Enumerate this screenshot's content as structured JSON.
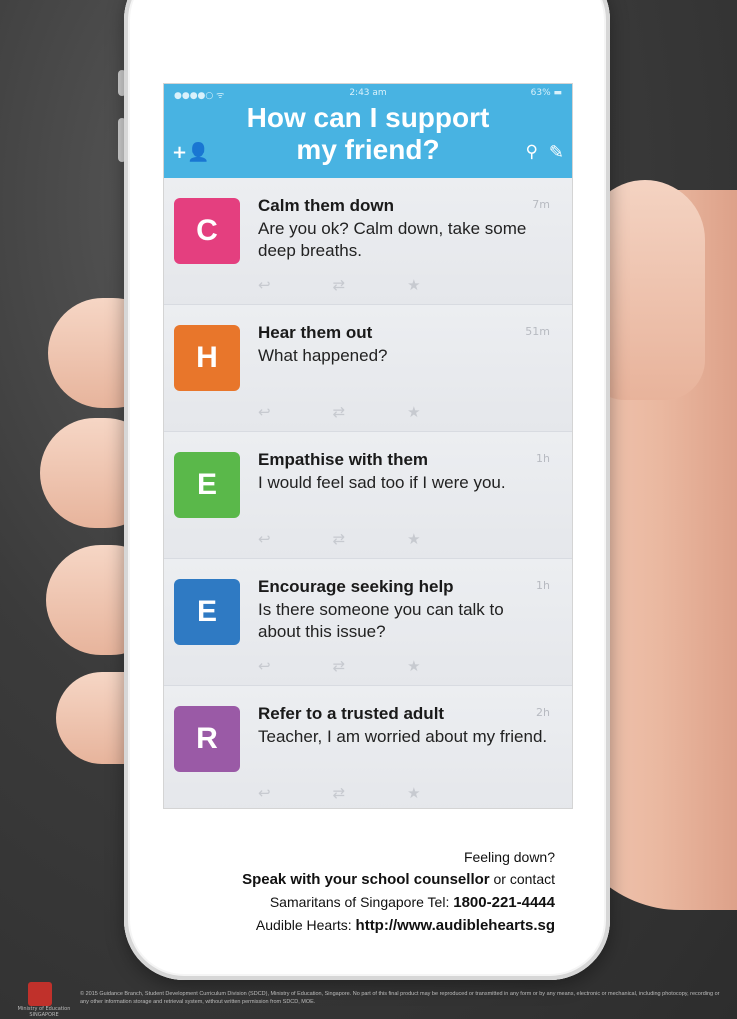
{
  "status_bar": {
    "signal": "●●●●○ ᯤ",
    "time": "2:43 am",
    "battery": "63% ▬"
  },
  "header": {
    "title_line1": "How can I support",
    "title_line2": "my friend?"
  },
  "icons": {
    "add_user": "+👤",
    "search": "⚲",
    "compose": "✎"
  },
  "feed": [
    {
      "letter": "C",
      "color": "#e43f7f",
      "title": "Calm them down",
      "text": "Are you ok? Calm down, take some deep breaths.",
      "time": "7m"
    },
    {
      "letter": "H",
      "color": "#e8762b",
      "title": "Hear them out",
      "text": "What happened?",
      "time": "51m"
    },
    {
      "letter": "E",
      "color": "#5ab84a",
      "title": "Empathise with them",
      "text": "I would feel sad too if I were you.",
      "time": "1h"
    },
    {
      "letter": "E",
      "color": "#2f7ac3",
      "title": "Encourage seeking help",
      "text": "Is there someone you can talk to about this issue?",
      "time": "1h"
    },
    {
      "letter": "R",
      "color": "#9a5aa6",
      "title": "Refer to a trusted adult",
      "text": "Teacher, I am worried about my friend.",
      "time": "2h"
    }
  ],
  "action_icons": {
    "reply": "↩",
    "retweet": "⇄",
    "favorite": "★"
  },
  "footer": {
    "line1": "Feeling down?",
    "line2_bold": "Speak with your school counsellor",
    "line2_rest": " or contact",
    "line3_text": "Samaritans of Singapore Tel: ",
    "line3_bold": "1800-221-4444",
    "line4_text": "Audible Hearts: ",
    "line4_bold": "http://www.audiblehearts.sg"
  },
  "copyright": "© 2015 Guidance Branch, Student Development Curriculum Division (SDCD), Ministry of Education, Singapore. No part of this final product may be reproduced or transmitted in any form or by any means, electronic or mechanical, including photocopy, recording or any other information storage and retrieval system, without written permission from SDCD, MOE.",
  "logo_text": "Ministry of Education SINGAPORE"
}
